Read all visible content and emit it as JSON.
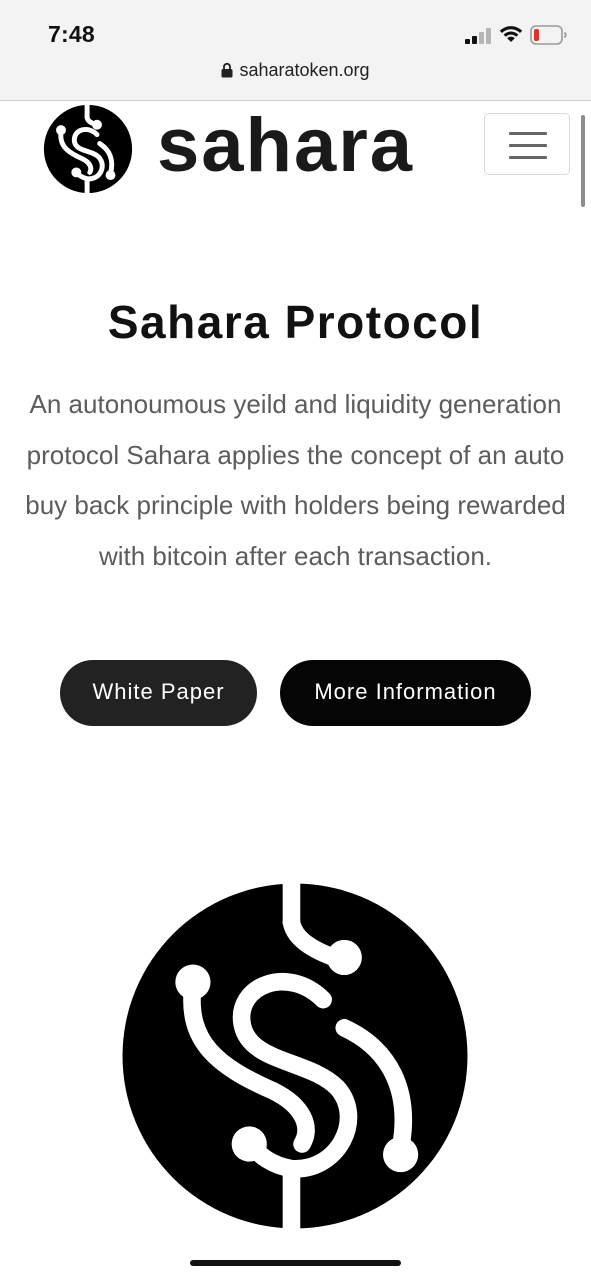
{
  "status_bar": {
    "time": "7:48",
    "signal_icon": "cellular-signal-icon",
    "wifi_icon": "wifi-icon",
    "battery_icon": "battery-low-icon",
    "battery_color": "#e0312b"
  },
  "browser": {
    "url": "saharatoken.org",
    "lock_icon": "lock-icon"
  },
  "header": {
    "brand_name": "sahara",
    "logo_icon": "sahara-dollar-logo-icon",
    "menu_icon": "hamburger-menu-icon"
  },
  "hero": {
    "title": "Sahara Protocol",
    "description": "An autonoumous yeild and liquidity generation protocol Sahara applies the concept of an auto buy back principle with holders being rewarded with bitcoin after each transaction.",
    "buttons": {
      "white_paper": "White Paper",
      "more_information": "More Information"
    },
    "logo_icon": "sahara-dollar-logo-icon"
  },
  "colors": {
    "text_dark": "#111111",
    "text_body": "#5c5c5c",
    "button_bg": "#050505",
    "status_bar_bg": "#f3f3f3"
  }
}
